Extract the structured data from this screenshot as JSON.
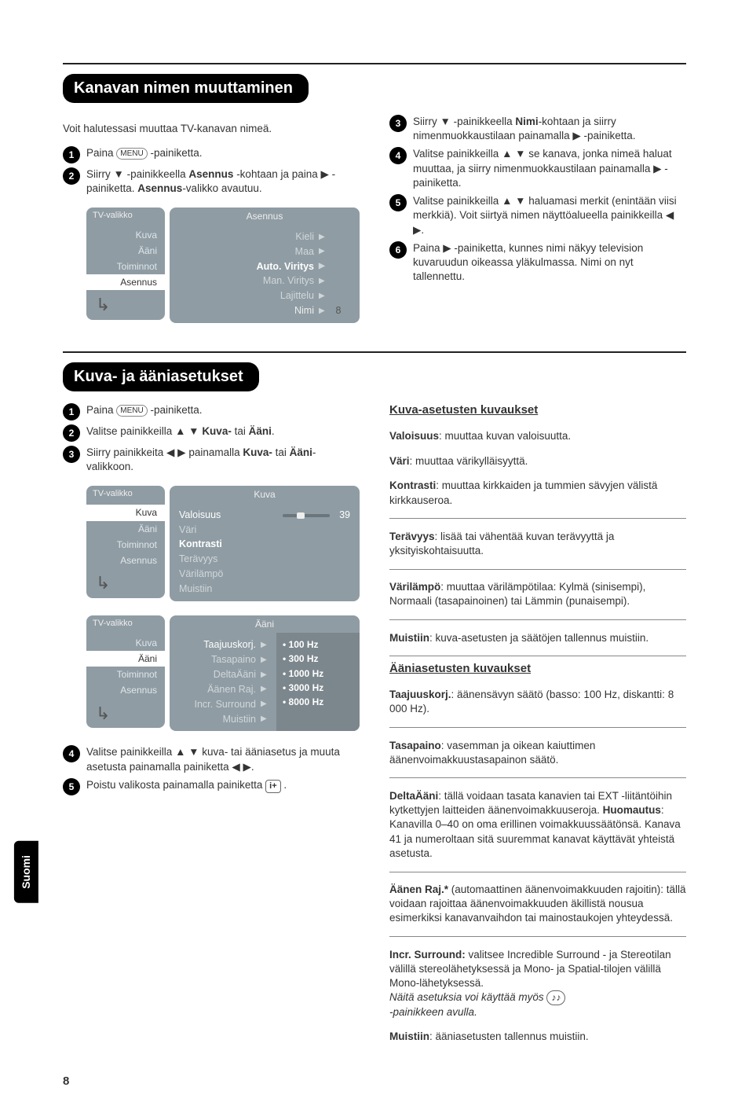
{
  "side_tab": "Suomi",
  "page_number": "8",
  "section1": {
    "title": "Kanavan nimen muuttaminen",
    "intro": "Voit halutessasi muuttaa TV-kanavan nimeä.",
    "left_steps": {
      "s1_a": "Paina ",
      "s1_b": " -painiketta.",
      "s2_a": "Siirry ",
      "s2_b": " -painikkeella ",
      "s2_bold1": "Asennus",
      "s2_c": " -kohtaan ja paina ",
      "s2_d": " -painiketta. ",
      "s2_bold2": "Asennus",
      "s2_e": "-valikko avautuu."
    },
    "osd1": {
      "left_head": "TV-valikko",
      "left_items": [
        "Kuva",
        "Ääni",
        "Toiminnot",
        "Asennus"
      ],
      "left_active": "Asennus",
      "right_head": "Asennus",
      "rows": [
        {
          "label": "Kieli",
          "dim": true
        },
        {
          "label": "Maa",
          "dim": true
        },
        {
          "label": "Auto. Viritys",
          "bold": true
        },
        {
          "label": "Man. Viritys",
          "dim": true
        },
        {
          "label": "Lajittelu",
          "dim": true
        },
        {
          "label": "Nimi",
          "dim": false,
          "value": "8"
        }
      ]
    },
    "right_steps": {
      "s3_a": "Siirry ",
      "s3_b": " -painikkeella ",
      "s3_bold": "Nimi",
      "s3_c": "-kohtaan ja siirry nimenmuokkaustilaan painamalla ",
      "s3_d": " -painiketta.",
      "s4_a": "Valitse painikkeilla ",
      "s4_b": " se kanava, jonka nimeä haluat muuttaa, ja siirry nimenmuokkaustilaan painamalla ",
      "s4_c": " -painiketta.",
      "s5_a": "Valitse painikkeilla ",
      "s5_b": " haluamasi merkit (enintään viisi merkkiä). Voit siirtyä nimen näyttöalueella painikkeilla ",
      "s5_c": ".",
      "s6_a": "Paina ",
      "s6_b": " -painiketta, kunnes nimi näkyy television kuvaruudun oikeassa yläkulmassa. Nimi on nyt tallennettu."
    }
  },
  "section2": {
    "title": "Kuva- ja ääniasetukset",
    "left_steps": {
      "s1_a": "Paina ",
      "s1_b": " -painiketta.",
      "s2_a": "Valitse painikkeilla ",
      "s2_bold1": "Kuva-",
      "s2_b": " tai ",
      "s2_bold2": "Ääni",
      "s2_c": ".",
      "s3_a": "Siirry painikkeita ",
      "s3_b": " painamalla ",
      "s3_bold1": "Kuva-",
      "s3_c": " tai ",
      "s3_bold2": "Ääni",
      "s3_d": "-valikkoon."
    },
    "osd_kuva": {
      "left_head": "TV-valikko",
      "left_items": [
        "Kuva",
        "Ääni",
        "Toiminnot",
        "Asennus"
      ],
      "left_active": "Kuva",
      "right_head": "Kuva",
      "rows": [
        {
          "label": "Valoisuus",
          "value": "39",
          "slider": true
        },
        {
          "label": "Väri",
          "dim": true
        },
        {
          "label": "Kontrasti",
          "bold": true
        },
        {
          "label": "Terävyys",
          "dim": true
        },
        {
          "label": "Värilämpö",
          "dim": true
        },
        {
          "label": "Muistiin",
          "dim": true
        }
      ]
    },
    "osd_aani": {
      "left_head": "TV-valikko",
      "left_items": [
        "Kuva",
        "Ääni",
        "Toiminnot",
        "Asennus"
      ],
      "left_active": "Ääni",
      "right_head": "Ääni",
      "left_rows": [
        "Taajuuskorj.",
        "Tasapaino",
        "DeltaÄäni",
        "Äänen Raj.",
        "Incr. Surround",
        "Muistiin"
      ],
      "right_rows": [
        "• 100 Hz",
        "• 300 Hz",
        "• 1000 Hz",
        "• 3000 Hz",
        "• 8000 Hz"
      ]
    },
    "left_tail": {
      "s4_a": "Valitse painikkeilla ",
      "s4_b": " kuva- tai ääniasetus ja muuta asetusta painamalla painiketta ",
      "s4_c": ".",
      "s5_a": "Poistu valikosta painamalla painiketta ",
      "s5_b": " ."
    },
    "desc": {
      "kuva_head": "Kuva-asetusten kuvaukset",
      "valoisuus_label": "Valoisuus",
      "valoisuus_text": ": muuttaa kuvan valoisuutta.",
      "vari_label": "Väri",
      "vari_text": ": muuttaa värikylläisyyttä.",
      "kontrasti_label": "Kontrasti",
      "kontrasti_text": ": muuttaa kirkkaiden ja tummien sävyjen välistä kirkkauseroa.",
      "teravyys_label": "Terävyys",
      "teravyys_text": ": lisää tai vähentää kuvan terävyyttä ja yksityiskohtaisuutta.",
      "varilampo_label": "Värilämpö",
      "varilampo_text": ": muuttaa värilämpötilaa: Kylmä (sinisempi), Normaali (tasapainoinen) tai Lämmin (punaisempi).",
      "muistiin_label": "Muistiin",
      "muistiin_text": ": kuva-asetusten ja säätöjen tallennus muistiin.",
      "aani_head": "Ääniasetusten kuvaukset",
      "taajuus_label": "Taajuuskorj.",
      "taajuus_text": ": äänensävyn säätö (basso: 100 Hz, diskantti: 8 000 Hz).",
      "tasapaino_label": "Tasapaino",
      "tasapaino_text": ": vasemman ja oikean kaiuttimen äänenvoimakkuustasapainon säätö.",
      "delta_label": "DeltaÄäni",
      "delta_text": ": tällä voidaan tasata kanavien tai EXT -liitäntöihin kytkettyjen laitteiden äänenvoimakkuuseroja. ",
      "huom_label": "Huomautus",
      "huom_text": ": Kanavilla 0–40 on oma erillinen voimakkuussäätönsä. Kanava 41 ja numeroltaan sitä suuremmat kanavat käyttävät yhteistä asetusta.",
      "raj_label": "Äänen Raj.*",
      "raj_text": " (automaattinen äänenvoimakkuuden rajoitin): tällä voidaan rajoittaa äänenvoimakkuuden äkillistä nousua esimerkiksi kanavanvaihdon tai mainostaukojen yhteydessä.",
      "incr_label": "Incr. Surround:",
      "incr_text": " valitsee Incredible Surround - ja Stereotilan välillä stereolähetyksessä ja Mono- ja Spatial-tilojen välillä Mono-lähetyksessä.",
      "incr_italic_a": "Näitä asetuksia voi käyttää myös ",
      "incr_italic_b": " -painikkeen avulla.",
      "muistiin2_label": "Muistiin",
      "muistiin2_text": ": ääniasetusten tallennus muistiin."
    }
  },
  "glyphs": {
    "menu": "MENU",
    "info": "i+",
    "sound": "♪♪"
  }
}
